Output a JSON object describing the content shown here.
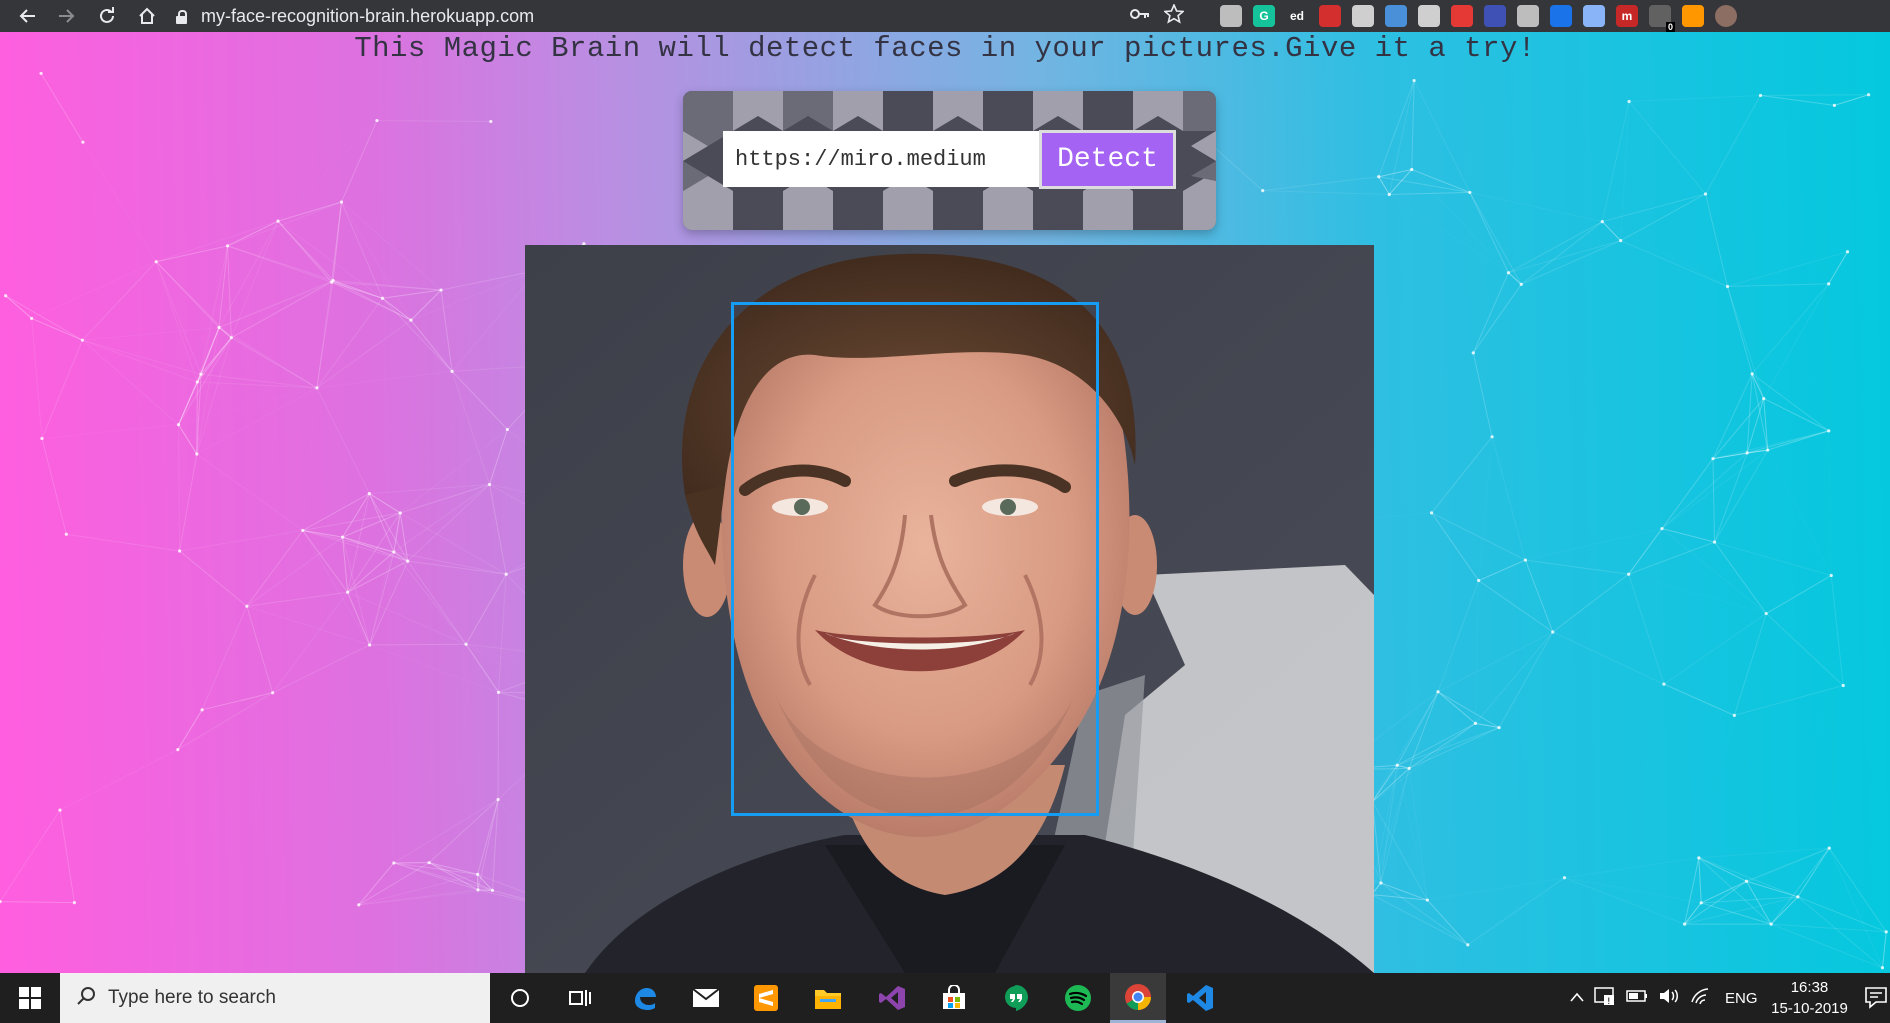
{
  "browser": {
    "url": "my-face-recognition-brain.herokuapp.com",
    "icons": [
      "back-icon",
      "forward-icon",
      "reload-icon",
      "home-icon",
      "lock-icon",
      "key-icon",
      "star-icon"
    ],
    "extensions": [
      {
        "name": "cube-extension-icon",
        "color": "#bdbdbd",
        "label": ""
      },
      {
        "name": "grammarly-extension-icon",
        "color": "#15c39a",
        "label": "G"
      },
      {
        "name": "ed-extension-icon",
        "color": "#35363a",
        "label": "ed"
      },
      {
        "name": "pdf-extension-icon",
        "color": "#d32f2f",
        "label": ""
      },
      {
        "name": "bulb-extension-icon",
        "color": "#cfcfcf",
        "label": ""
      },
      {
        "name": "circle-extension-icon",
        "color": "#4a90d9",
        "label": ""
      },
      {
        "name": "target-extension-icon",
        "color": "#cfcfcf",
        "label": ""
      },
      {
        "name": "puzzle-red-extension-icon",
        "color": "#e53935",
        "label": ""
      },
      {
        "name": "translate-extension-icon",
        "color": "#3f51b5",
        "label": ""
      },
      {
        "name": "cloud-extension-icon",
        "color": "#bdbdbd",
        "label": ""
      },
      {
        "name": "bookmark-extension-icon",
        "color": "#1a73e8",
        "label": ""
      },
      {
        "name": "chat-extension-icon",
        "color": "#8ab4f8",
        "label": ""
      },
      {
        "name": "m-extension-icon",
        "color": "#c62828",
        "label": "m"
      },
      {
        "name": "counter-extension-icon",
        "color": "#616161",
        "label": "",
        "badge": "0"
      },
      {
        "name": "fox-extension-icon",
        "color": "#ff9800",
        "label": ""
      },
      {
        "name": "profile-avatar",
        "color": "#8d6e63",
        "label": ""
      }
    ]
  },
  "page": {
    "tagline": "This Magic Brain will detect faces in your pictures.Give it a try!",
    "input_value": "https://miro.medium",
    "detect_label": "Detect",
    "face_box_color": "#149df2"
  },
  "taskbar": {
    "search_placeholder": "Type here to search",
    "apps": [
      "cortana-icon",
      "task-view-icon",
      "edge-icon",
      "mail-icon",
      "sublime-icon",
      "file-explorer-icon",
      "visual-studio-icon",
      "store-icon",
      "hangouts-icon",
      "spotify-icon",
      "chrome-icon",
      "vscode-icon"
    ],
    "language": "ENG",
    "time": "16:38",
    "date": "15-10-2019"
  }
}
